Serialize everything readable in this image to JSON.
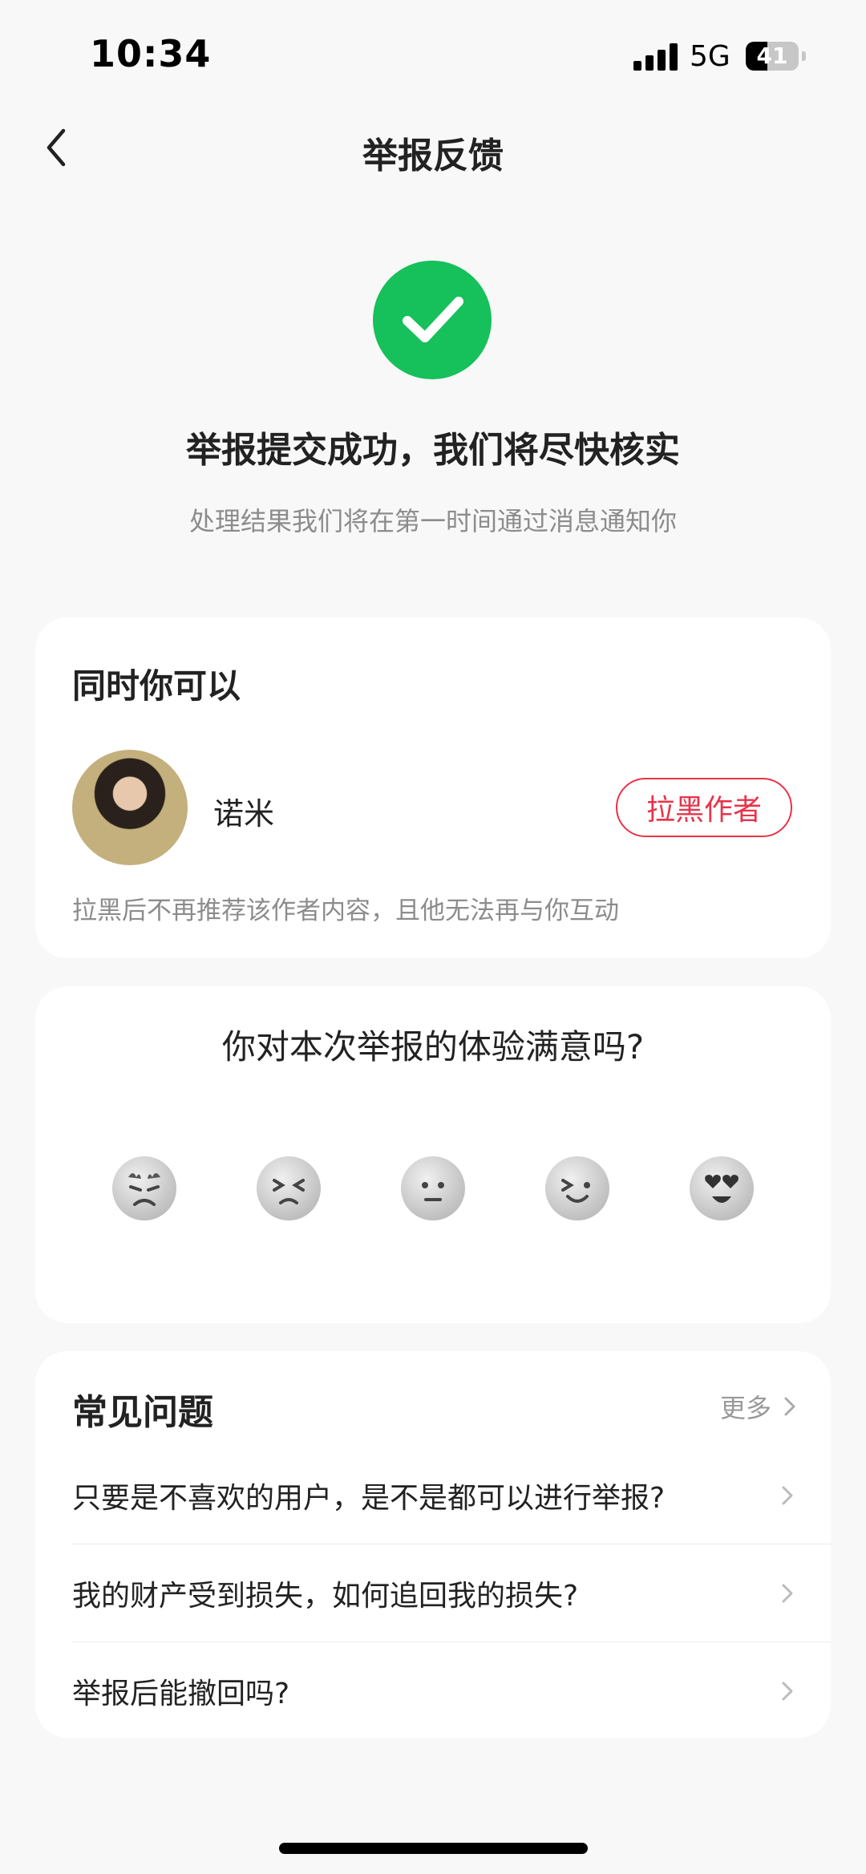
{
  "status_bar": {
    "time": "10:34",
    "network": "5G",
    "battery_level": "41",
    "battery_fraction": 0.41
  },
  "nav": {
    "title": "举报反馈",
    "back_icon": "chevron-left-icon"
  },
  "success": {
    "icon": "check-circle-icon",
    "icon_color": "#16c05a",
    "title": "举报提交成功，我们将尽快核实",
    "subtitle": "处理结果我们将在第一时间通过消息通知你"
  },
  "blacklist_card": {
    "heading": "同时你可以",
    "author_name": "诺米",
    "button_label": "拉黑作者",
    "button_color": "#e8334a",
    "note": "拉黑后不再推荐该作者内容，且他无法再与你互动"
  },
  "rating_card": {
    "title": "你对本次举报的体验满意吗?",
    "options": [
      "very-angry-face-icon",
      "unhappy-face-icon",
      "neutral-face-icon",
      "smiling-face-icon",
      "heart-eyes-face-icon"
    ]
  },
  "faq_card": {
    "heading": "常见问题",
    "more_label": "更多",
    "items": [
      "只要是不喜欢的用户，是不是都可以进行举报?",
      "我的财产受到损失，如何追回我的损失?",
      "举报后能撤回吗?"
    ]
  }
}
